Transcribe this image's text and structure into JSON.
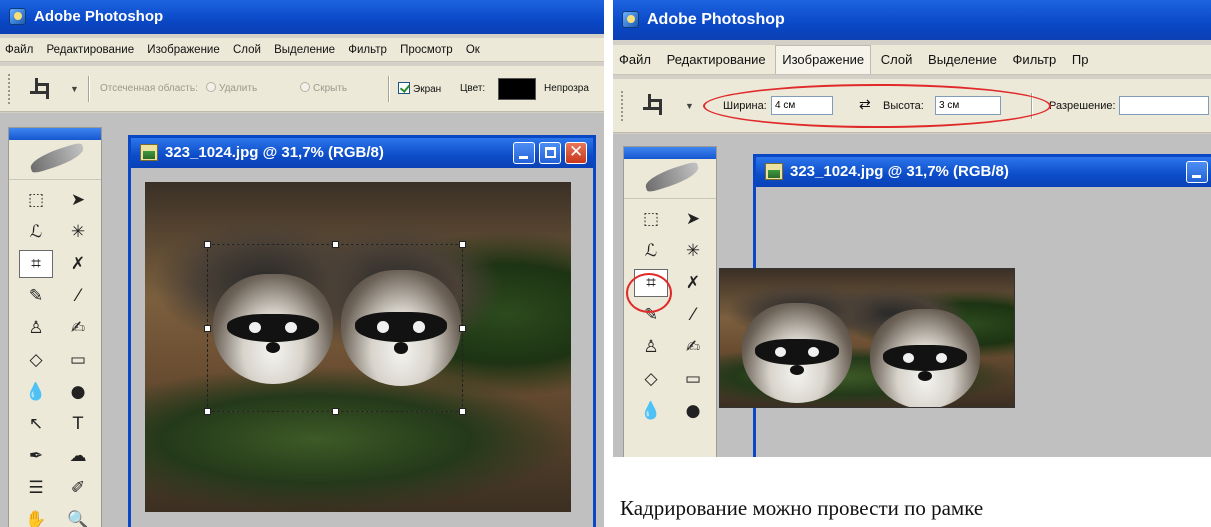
{
  "left_screen": {
    "app_title": "Adobe Photoshop",
    "menu": [
      "Файл",
      "Редактирование",
      "Изображение",
      "Слой",
      "Выделение",
      "Фильтр",
      "Просмотр",
      "Ок"
    ],
    "options": {
      "cropped_area_label": "Отсеченная область:",
      "delete_label": "Удалить",
      "hide_label": "Скрыть",
      "screen_label": "Экран",
      "color_label": "Цвет:",
      "opacity_label": "Непрозра"
    },
    "document": {
      "title": "323_1024.jpg @ 31,7% (RGB/8)"
    }
  },
  "right_screen": {
    "app_title": "Adobe Photoshop",
    "menu": [
      "Файл",
      "Редактирование",
      "Изображение",
      "Слой",
      "Выделение",
      "Фильтр",
      "Пр"
    ],
    "options": {
      "width_label": "Ширина:",
      "width_value": "4 см",
      "height_label": "Высота:",
      "height_value": "3 см",
      "resolution_label": "Разрешение:"
    },
    "document": {
      "title": "323_1024.jpg @ 31,7% (RGB/8)"
    }
  },
  "caption": "Кадрирование можно провести по рамке",
  "colors": {
    "title_blue": "#0a48c6",
    "annotation_red": "#e02a2a"
  }
}
